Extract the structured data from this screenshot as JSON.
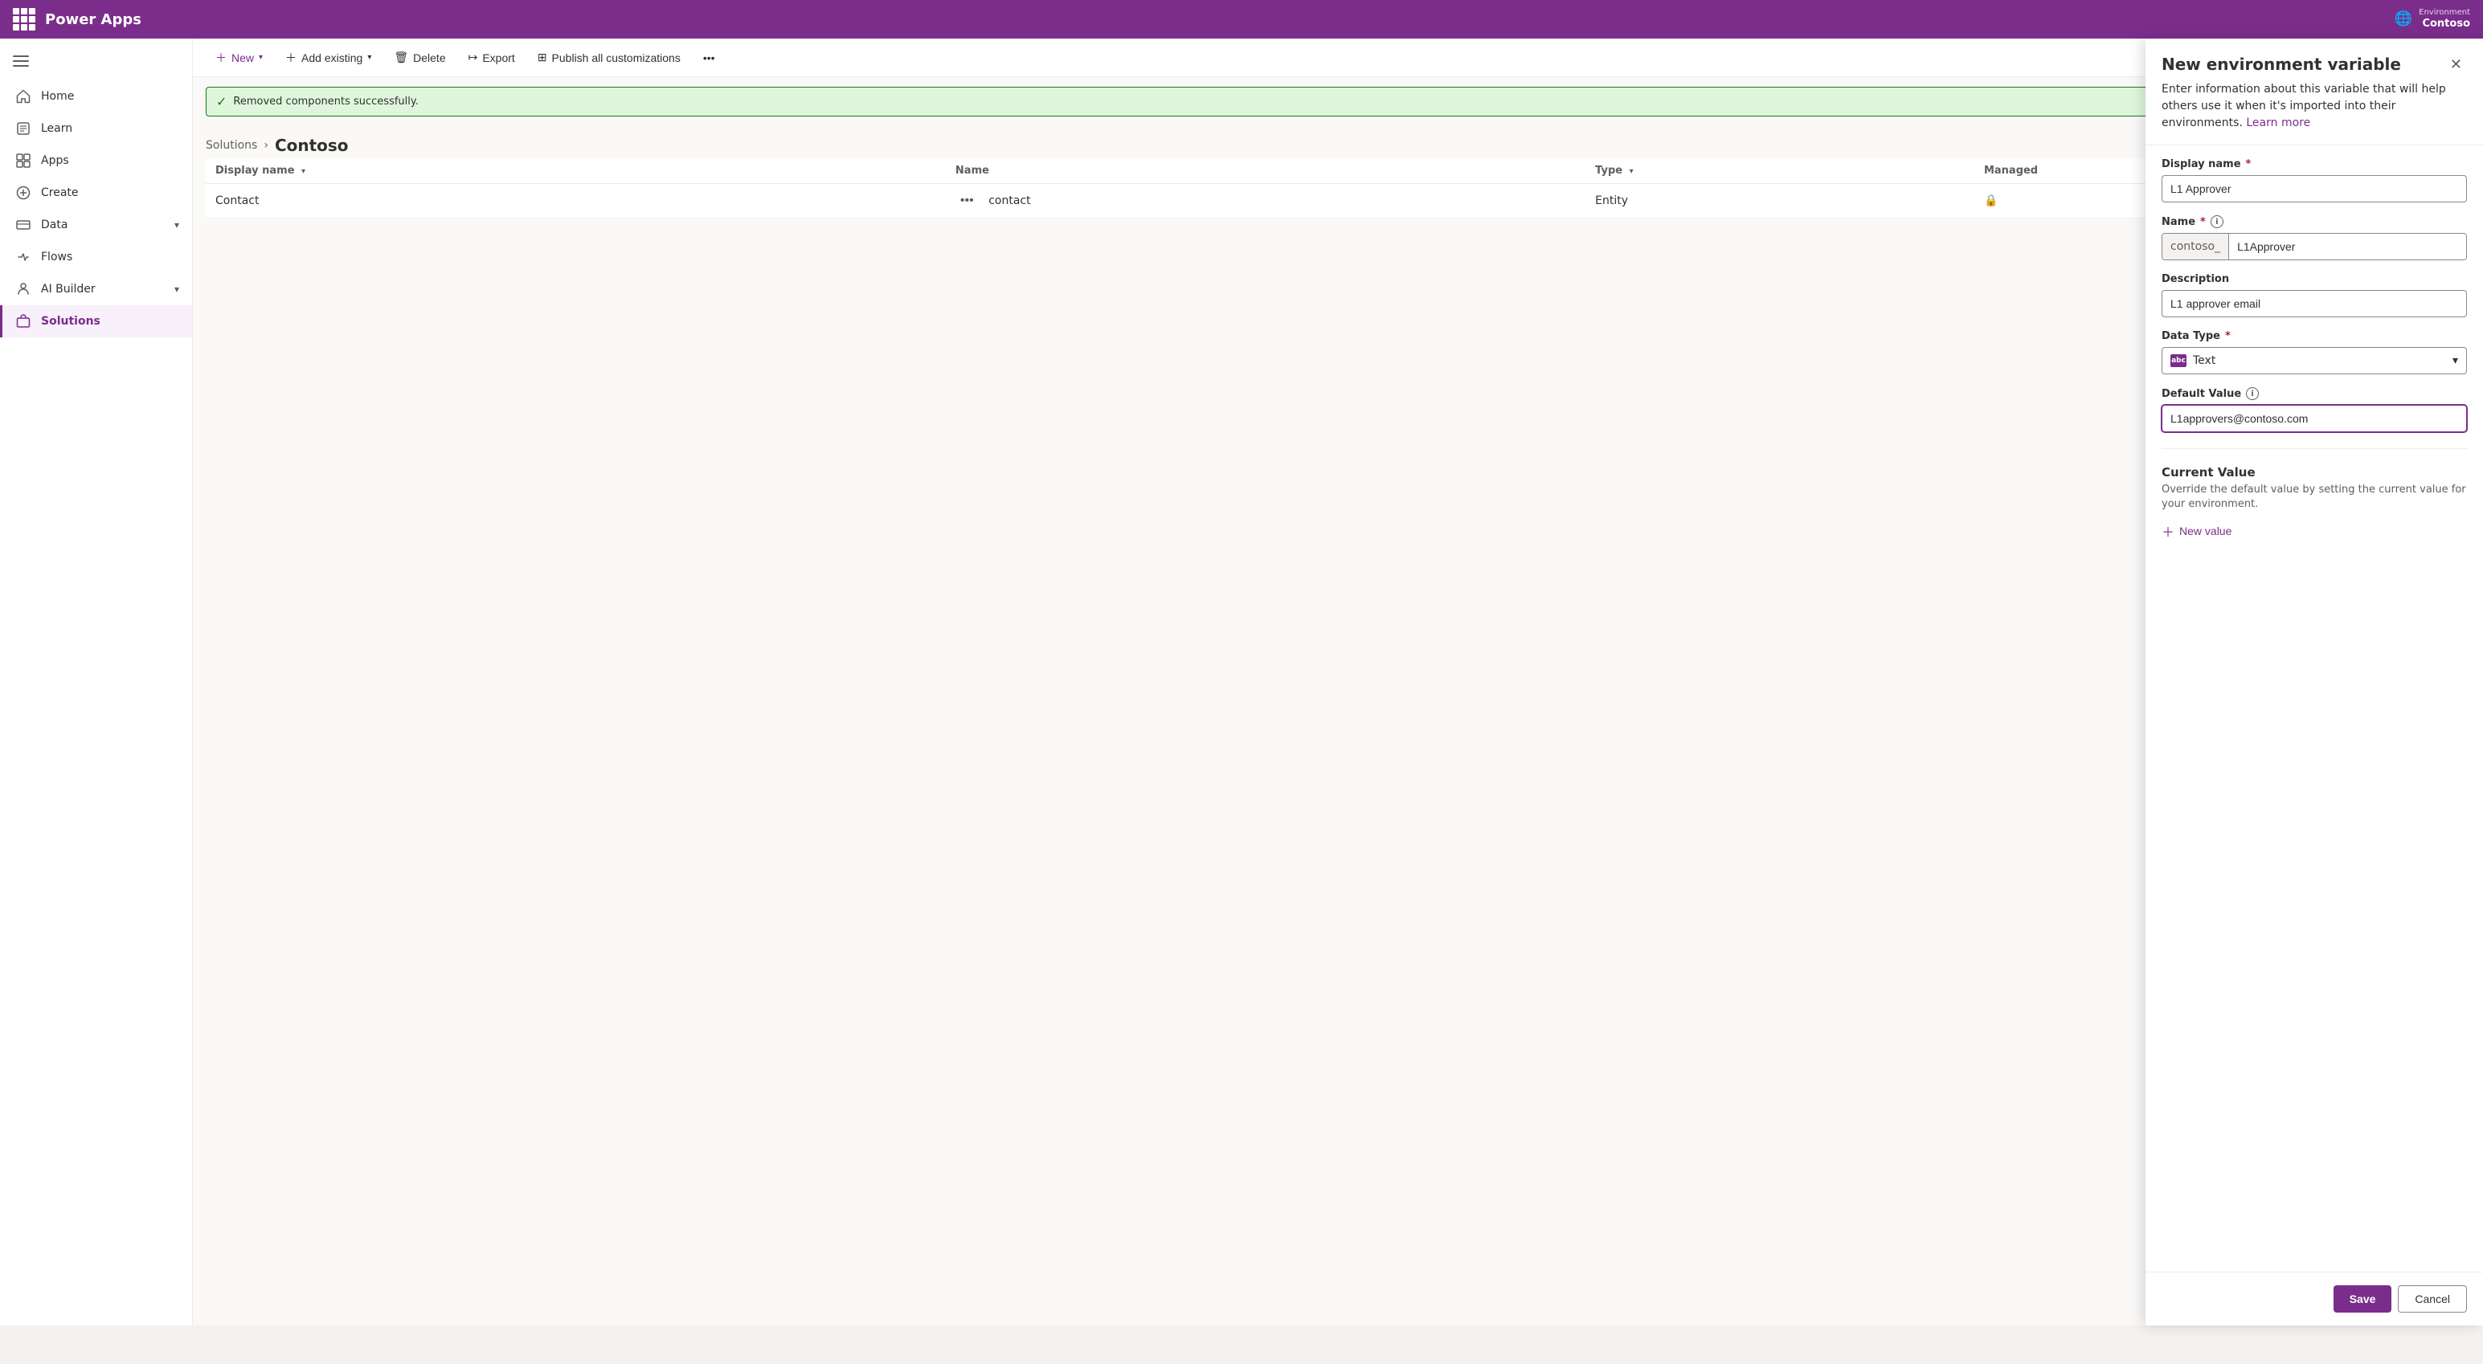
{
  "app": {
    "title": "Power Apps"
  },
  "topbar": {
    "env_label": "Environment",
    "env_name": "Contoso"
  },
  "sidebar": {
    "hamburger_label": "Collapse",
    "items": [
      {
        "id": "home",
        "label": "Home",
        "icon": "🏠",
        "active": false
      },
      {
        "id": "learn",
        "label": "Learn",
        "icon": "📖",
        "active": false
      },
      {
        "id": "apps",
        "label": "Apps",
        "icon": "📱",
        "active": false
      },
      {
        "id": "create",
        "label": "Create",
        "icon": "➕",
        "active": false
      },
      {
        "id": "data",
        "label": "Data",
        "icon": "🗄",
        "active": false,
        "chevron": true
      },
      {
        "id": "flows",
        "label": "Flows",
        "icon": "〰",
        "active": false
      },
      {
        "id": "ai-builder",
        "label": "AI Builder",
        "icon": "🤖",
        "active": false,
        "chevron": true
      },
      {
        "id": "solutions",
        "label": "Solutions",
        "icon": "📦",
        "active": true
      }
    ]
  },
  "toolbar": {
    "new_label": "New",
    "add_existing_label": "Add existing",
    "delete_label": "Delete",
    "export_label": "Export",
    "publish_label": "Publish all customizations",
    "more_label": "More"
  },
  "success_banner": {
    "message": "Removed components successfully."
  },
  "breadcrumb": {
    "solutions_label": "Solutions",
    "current": "Contoso"
  },
  "table": {
    "columns": [
      {
        "id": "display_name",
        "label": "Display name"
      },
      {
        "id": "name",
        "label": "Name"
      },
      {
        "id": "type",
        "label": "Type"
      },
      {
        "id": "managed",
        "label": "Managed"
      }
    ],
    "rows": [
      {
        "display_name": "Contact",
        "name": "contact",
        "type": "Entity",
        "managed": true
      }
    ]
  },
  "panel": {
    "title": "New environment variable",
    "description": "Enter information about this variable that will help others use it when it's imported into their environments.",
    "learn_more": "Learn more",
    "display_name_label": "Display name",
    "display_name_required": true,
    "display_name_value": "L1 Approver",
    "name_label": "Name",
    "name_required": true,
    "name_prefix": "contoso_",
    "name_value": "L1Approver",
    "description_label": "Description",
    "description_value": "L1 approver email",
    "data_type_label": "Data Type",
    "data_type_required": true,
    "data_type_value": "Text",
    "data_type_icon": "abc",
    "default_value_label": "Default Value",
    "default_value_value": "L1approvers@contoso.com",
    "current_value_title": "Current Value",
    "current_value_desc": "Override the default value by setting the current value for your environment.",
    "new_value_label": "New value",
    "save_label": "Save",
    "cancel_label": "Cancel",
    "close_icon": "✕"
  }
}
